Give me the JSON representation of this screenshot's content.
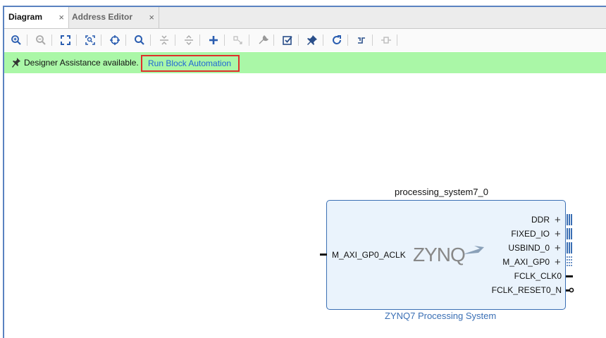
{
  "tabs": [
    {
      "label": "Diagram",
      "close": "×"
    },
    {
      "label": "Address Editor",
      "close": "×"
    }
  ],
  "toolbar": {
    "icons": [
      "zoom-in-icon",
      "zoom-out-icon",
      "zoom-fit-icon",
      "zoom-selection-icon",
      "center-icon",
      "search-icon",
      "collapse-all-icon",
      "expand-all-icon",
      "add-ip-icon",
      "make-connection-icon",
      "properties-icon",
      "validate-design-icon",
      "pin-icon",
      "regenerate-layout-icon",
      "optimize-routing-icon",
      "make-external-icon"
    ]
  },
  "assist": {
    "label": "Designer Assistance available.",
    "link": "Run Block Automation"
  },
  "block": {
    "instance_name": "processing_system7_0",
    "ip_name": "ZYNQ7 Processing System",
    "logo_text": "ZYNQ",
    "input_port": "M_AXI_GP0_ACLK",
    "output_ports": [
      {
        "label": "DDR",
        "type": "bus"
      },
      {
        "label": "FIXED_IO",
        "type": "bus"
      },
      {
        "label": "USBIND_0",
        "type": "bus"
      },
      {
        "label": "M_AXI_GP0",
        "type": "bus"
      },
      {
        "label": "FCLK_CLK0",
        "type": "clock"
      },
      {
        "label": "FCLK_RESET0_N",
        "type": "reset"
      }
    ],
    "plus_symbol": "+"
  },
  "colors": {
    "assist_bg": "#aaf7a7",
    "link": "#1f66d6",
    "highlight_border": "#e0302a",
    "block_border": "#3a6fb4",
    "block_fill": "#eaf3fc"
  }
}
